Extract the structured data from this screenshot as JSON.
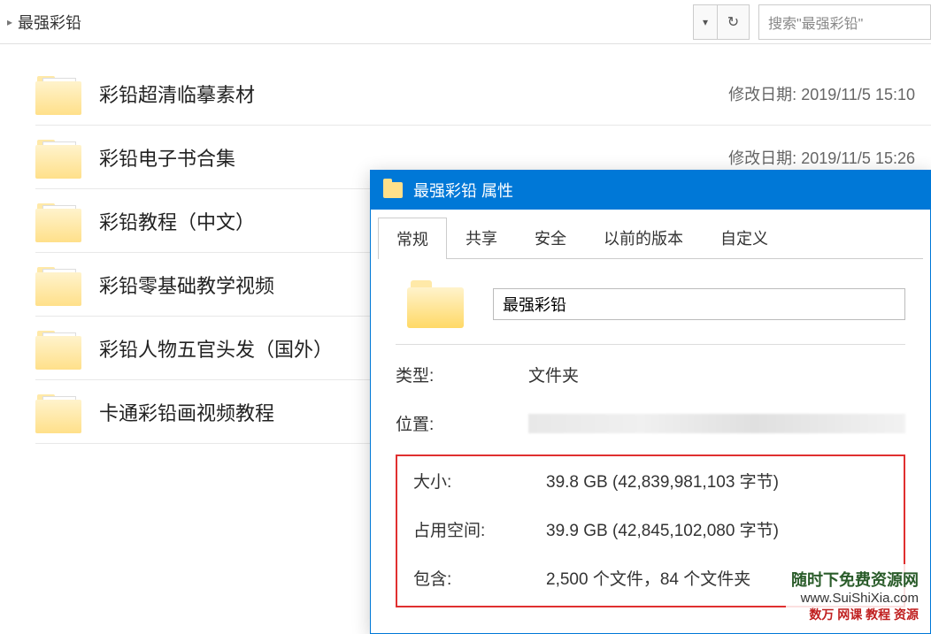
{
  "addressBar": {
    "currentFolder": "最强彩铅",
    "searchPlaceholder": "搜索\"最强彩铅\""
  },
  "fileList": [
    {
      "name": "彩铅超清临摹素材",
      "metaLabel": "修改日期:",
      "metaValue": "2019/11/5 15:10"
    },
    {
      "name": "彩铅电子书合集",
      "metaLabel": "修改日期:",
      "metaValue": "2019/11/5 15:26"
    },
    {
      "name": "彩铅教程（中文）",
      "metaLabel": "",
      "metaValue": ""
    },
    {
      "name": "彩铅零基础教学视频",
      "metaLabel": "",
      "metaValue": ""
    },
    {
      "name": "彩铅人物五官头发（国外）",
      "metaLabel": "",
      "metaValue": ""
    },
    {
      "name": "卡通彩铅画视频教程",
      "metaLabel": "",
      "metaValue": ""
    }
  ],
  "properties": {
    "title": "最强彩铅 属性",
    "tabs": [
      "常规",
      "共享",
      "安全",
      "以前的版本",
      "自定义"
    ],
    "folderName": "最强彩铅",
    "typeLabel": "类型:",
    "typeValue": "文件夹",
    "locationLabel": "位置:",
    "sizeLabel": "大小:",
    "sizeValue": "39.8 GB (42,839,981,103 字节)",
    "diskLabel": "占用空间:",
    "diskValue": "39.9 GB (42,845,102,080 字节)",
    "containsLabel": "包含:",
    "containsValue": "2,500 个文件，84 个文件夹"
  },
  "watermark": {
    "line1": "随时下免费资源网",
    "line2": "www.SuiShiXia.com",
    "line3": "数万 网课 教程 资源"
  }
}
